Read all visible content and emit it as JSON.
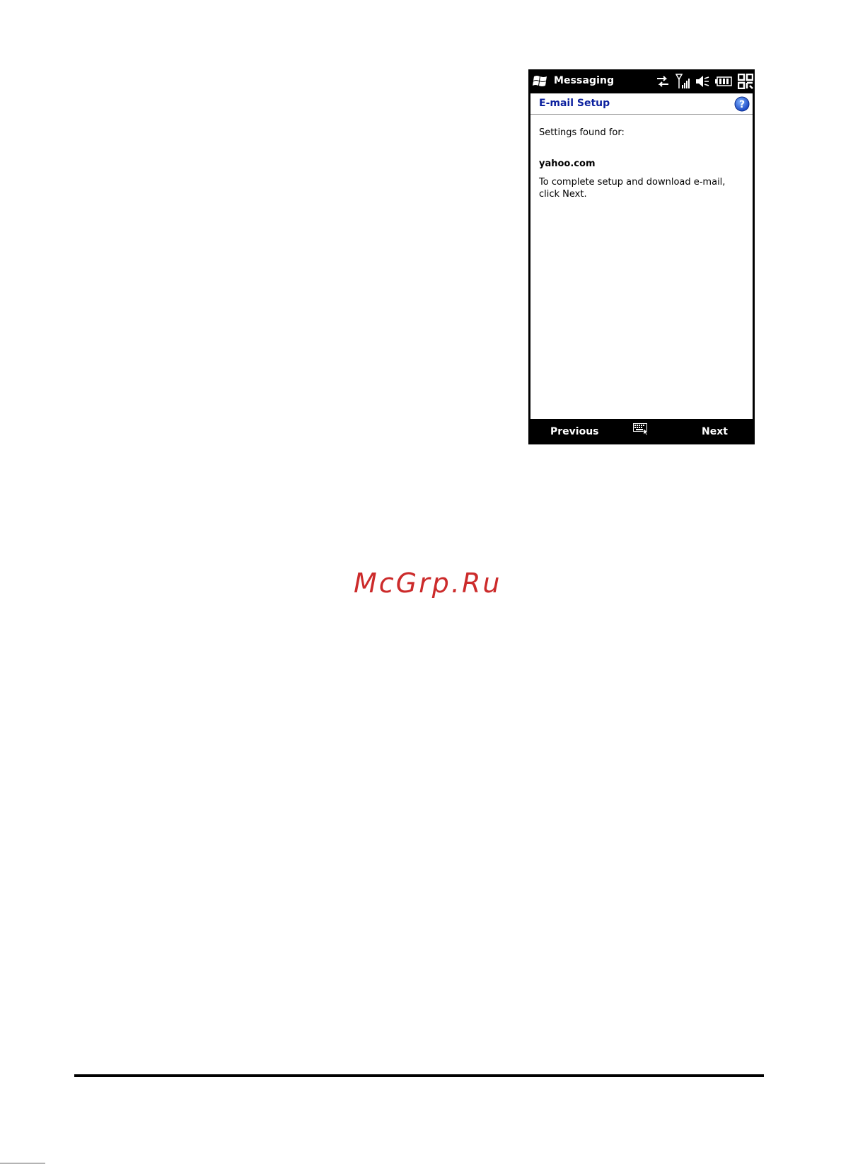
{
  "titlebar": {
    "app_title": "Messaging",
    "icons": [
      "windows-start-icon",
      "data-connection-icon",
      "signal-strength-icon",
      "speaker-mute-icon",
      "battery-icon",
      "ok-grid-icon"
    ]
  },
  "header": {
    "title": "E-mail Setup",
    "help_icon": "help-icon"
  },
  "content": {
    "settings_label": "Settings found for:",
    "domain": "yahoo.com",
    "instructions": "To complete setup and download e-mail, click Next."
  },
  "softkeys": {
    "left_label": "Previous",
    "right_label": "Next",
    "center_icon": "keyboard-icon"
  },
  "watermark": {
    "text": "McGrp.Ru"
  },
  "colors": {
    "header_title": "#0a1f9e",
    "watermark": "#cc2b2b",
    "bars": "#000000"
  }
}
